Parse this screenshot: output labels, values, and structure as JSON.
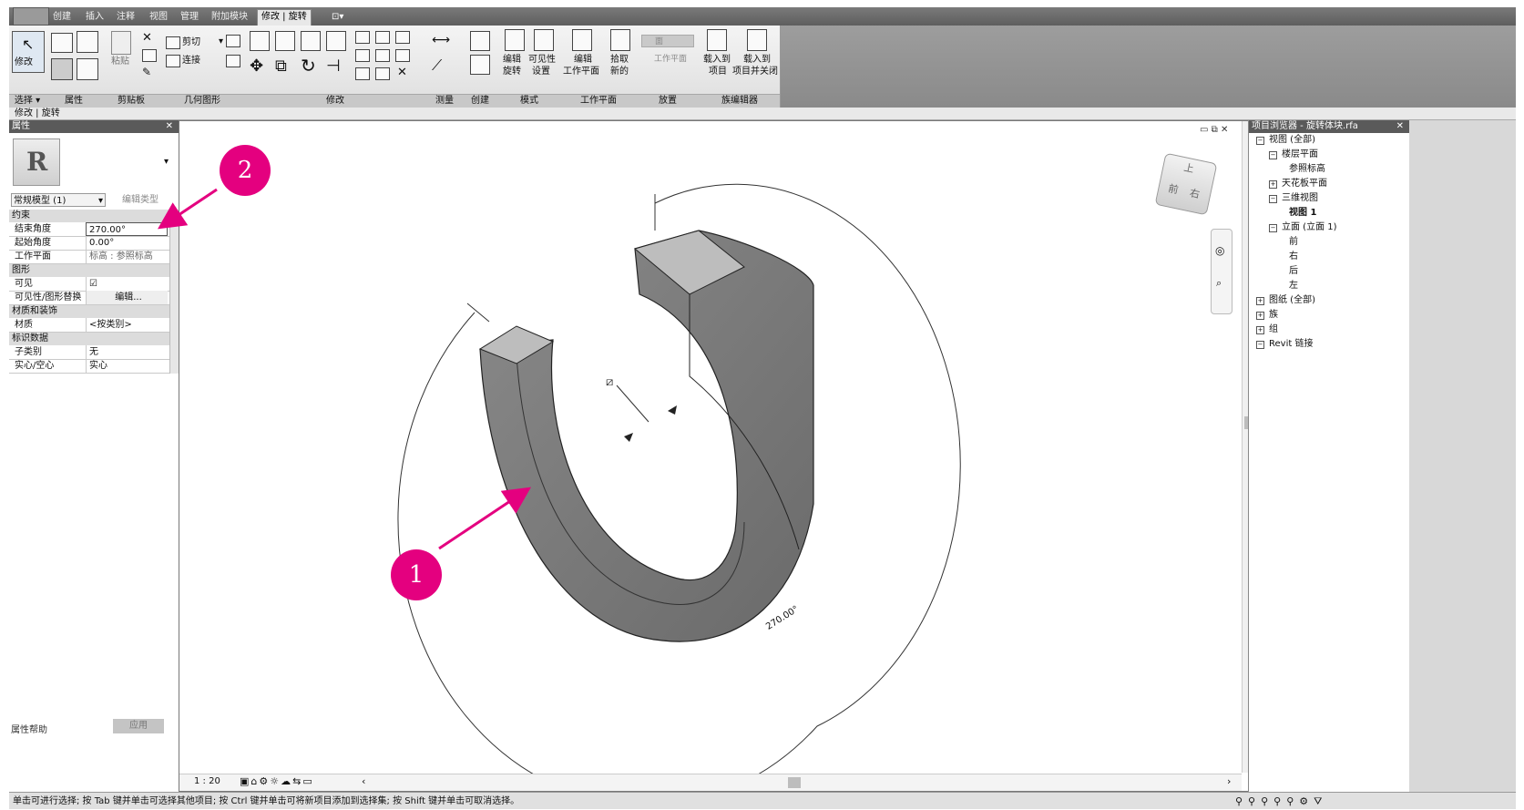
{
  "tabs": [
    "创建",
    "插入",
    "注释",
    "视图",
    "管理",
    "附加模块",
    "修改 | 旋转"
  ],
  "ribbon": {
    "modify_label": "修改",
    "select_label": "选择 ▾",
    "panels": {
      "properties": "属性",
      "clipboard": "剪贴板",
      "geometry": "几何图形",
      "modify": "修改",
      "measure": "测量",
      "create": "创建",
      "mode": "模式",
      "workplane": "工作平面",
      "place": "放置",
      "family_editor": "族编辑器"
    },
    "paste": "粘贴",
    "cut": "剪切",
    "join": "连接",
    "edit_revolve": [
      "编辑",
      "旋转"
    ],
    "visibility_settings": [
      "可见性",
      "设置"
    ],
    "edit_workplane": [
      "编辑",
      "工作平面"
    ],
    "pick_new": [
      "拾取",
      "新的"
    ],
    "place_face": "面",
    "place_workplane": "工作平面",
    "load_into_project": [
      "载入到",
      "项目"
    ],
    "load_close": [
      "载入到",
      "项目并关闭"
    ]
  },
  "context_bar": "修改 | 旋转",
  "properties": {
    "title": "属性",
    "type_name": "常规模型 (1)",
    "edit_type": "编辑类型",
    "sections": [
      "约束",
      "图形",
      "材质和装饰",
      "标识数据"
    ],
    "rows": [
      {
        "k": "结束角度",
        "v": "270.00°"
      },
      {
        "k": "起始角度",
        "v": "0.00°"
      },
      {
        "k": "工作平面",
        "v": "标高 : 参照标高"
      },
      {
        "k": "可见",
        "v": "☑"
      },
      {
        "k": "可见性/图形替换",
        "v": "编辑..."
      },
      {
        "k": "材质",
        "v": "<按类别>"
      },
      {
        "k": "子类别",
        "v": "无"
      },
      {
        "k": "实心/空心",
        "v": "实心"
      }
    ],
    "help": "属性帮助",
    "apply": "应用"
  },
  "viewport": {
    "scale": "1 : 20",
    "angle_label": "270.00°",
    "viewcube_top": "上",
    "viewcube_front": "前",
    "viewcube_right": "右"
  },
  "callouts": [
    "1",
    "2"
  ],
  "browser": {
    "title": "项目浏览器 - 旋转体块.rfa",
    "items": [
      {
        "label": "视图 (全部)",
        "indent": 0
      },
      {
        "label": "楼层平面",
        "indent": 1
      },
      {
        "label": "参照标高",
        "indent": 2
      },
      {
        "label": "天花板平面",
        "indent": 1
      },
      {
        "label": "三维视图",
        "indent": 1
      },
      {
        "label": "视图 1",
        "indent": 2
      },
      {
        "label": "立面 (立面 1)",
        "indent": 1
      },
      {
        "label": "前",
        "indent": 2
      },
      {
        "label": "右",
        "indent": 2
      },
      {
        "label": "后",
        "indent": 2
      },
      {
        "label": "左",
        "indent": 2
      },
      {
        "label": "图纸 (全部)",
        "indent": 0
      },
      {
        "label": "族",
        "indent": 0
      },
      {
        "label": "组",
        "indent": 0
      },
      {
        "label": "Revit 链接",
        "indent": 0
      }
    ]
  },
  "status": "单击可进行选择; 按 Tab 键并单击可选择其他项目; 按 Ctrl 键并单击可将新项目添加到选择集; 按 Shift 键并单击可取消选择。",
  "accent": "#e4007f"
}
